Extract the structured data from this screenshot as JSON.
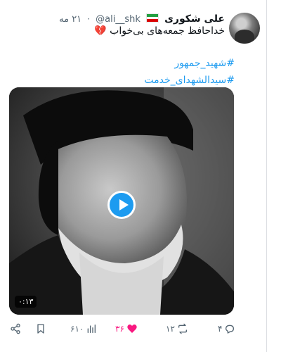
{
  "tweet": {
    "author_name": "علی شکوری",
    "handle": "@ali__shk",
    "separator": "·",
    "time": "۲۱ مه",
    "text": "خداحافظ جمعه‌های بی‌خواب",
    "text_emoji": "💔",
    "hashtags": [
      "#شهید_جمهور",
      "#سیدالشهدای_خدمت"
    ],
    "icons": [
      "iran-flag-icon",
      "broken-heart-icon"
    ]
  },
  "media": {
    "duration": "۰:۱۳",
    "icon": "play-icon"
  },
  "actions": {
    "reply_count": "۴",
    "retweet_count": "۱۲",
    "like_count": "۳۶",
    "views_count": "۶۱۰",
    "liked": true
  },
  "colors": {
    "accent": "#1d9bf0",
    "like": "#f91880",
    "muted": "#536471"
  }
}
